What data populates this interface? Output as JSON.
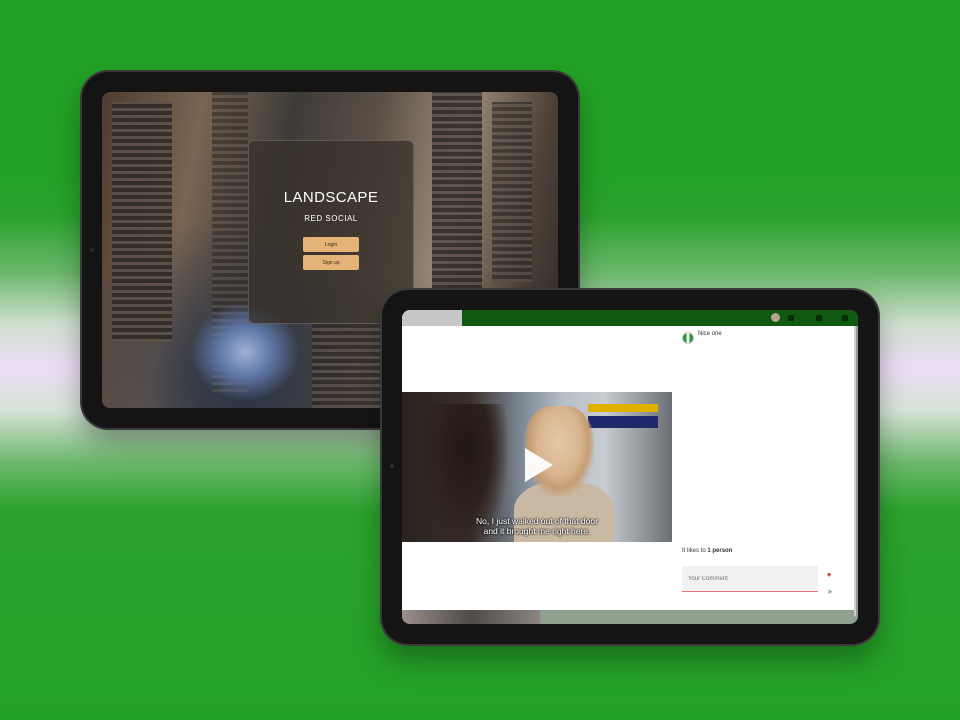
{
  "login_screen": {
    "app_title": "LANDSCAPE",
    "subtitle": "RED SOCIAL",
    "login_label": "Login",
    "signup_label": "Sign up"
  },
  "post_screen": {
    "comments": [
      {
        "text": "Nice one"
      }
    ],
    "video": {
      "subtitle_line1": "No, I just walked out of that door",
      "subtitle_line2": "and it brought me right here."
    },
    "likes_prefix": "It likes to",
    "likes_count": "1 person",
    "comment_placeholder": "Your Comment"
  },
  "colors": {
    "background_green": "#23a126",
    "button_tan": "#e5b378",
    "topbar_green": "#0f5a10",
    "heart_red": "#d42020"
  },
  "icons": [
    "play-icon",
    "heart-icon",
    "send-icon"
  ]
}
